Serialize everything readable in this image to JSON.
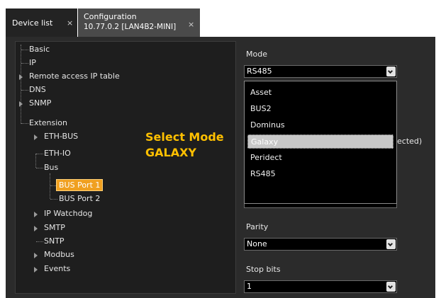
{
  "tabs": [
    {
      "label": "Device list",
      "close": "×"
    },
    {
      "title_line1": "Configuration",
      "title_line2": "10.77.0.2 [LAN4B2-MINI]",
      "close": "×"
    }
  ],
  "tree": {
    "basic": "Basic",
    "ip": "IP",
    "remote_access": "Remote access IP table",
    "dns": "DNS",
    "snmp": "SNMP",
    "extension": "Extension",
    "eth_bus": "ETH-BUS",
    "eth_io": "ETH-IO",
    "bus": "Bus",
    "bus_port_1": "BUS Port 1",
    "bus_port_2": "BUS Port 2",
    "ip_watchdog": "IP Watchdog",
    "smtp": "SMTP",
    "sntp": "SNTP",
    "modbus": "Modbus",
    "events": "Events"
  },
  "annotation": {
    "line1": "Select Mode",
    "line2": "GALAXY"
  },
  "form": {
    "mode_label": "Mode",
    "mode_value": "RS485",
    "mode_options": [
      "Asset",
      "BUS2",
      "Dominus",
      "Galaxy",
      "Peridect",
      "RS485"
    ],
    "hidden_suffix": "ected)",
    "parity_label": "Parity",
    "parity_value": "None",
    "stop_bits_label": "Stop bits",
    "stop_bits_value": "1"
  },
  "colors": {
    "highlight": "#f0a020",
    "annotation": "#ffc000"
  }
}
